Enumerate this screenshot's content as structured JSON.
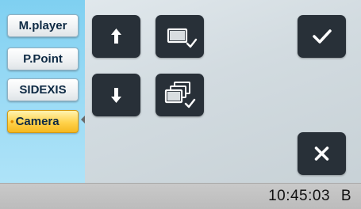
{
  "sidebar": {
    "items": [
      {
        "label": "M.player",
        "active": false
      },
      {
        "label": "P.Point",
        "active": false
      },
      {
        "label": "SIDEXIS",
        "active": false
      },
      {
        "label": "Camera",
        "active": true
      }
    ]
  },
  "controls": {
    "up_icon": "arrow-up-icon",
    "down_icon": "arrow-down-icon",
    "single_screen_icon": "single-screen-check-icon",
    "multi_screen_icon": "multi-screen-check-icon",
    "confirm_icon": "checkmark-icon",
    "close_icon": "close-icon"
  },
  "status": {
    "time": "10:45:03",
    "mode": "B"
  },
  "colors": {
    "sidebar_bg": "#8fd6f3",
    "active_item": "#ffd24a",
    "tile_bg": "#283038",
    "status_bg": "#c2c2c2"
  }
}
